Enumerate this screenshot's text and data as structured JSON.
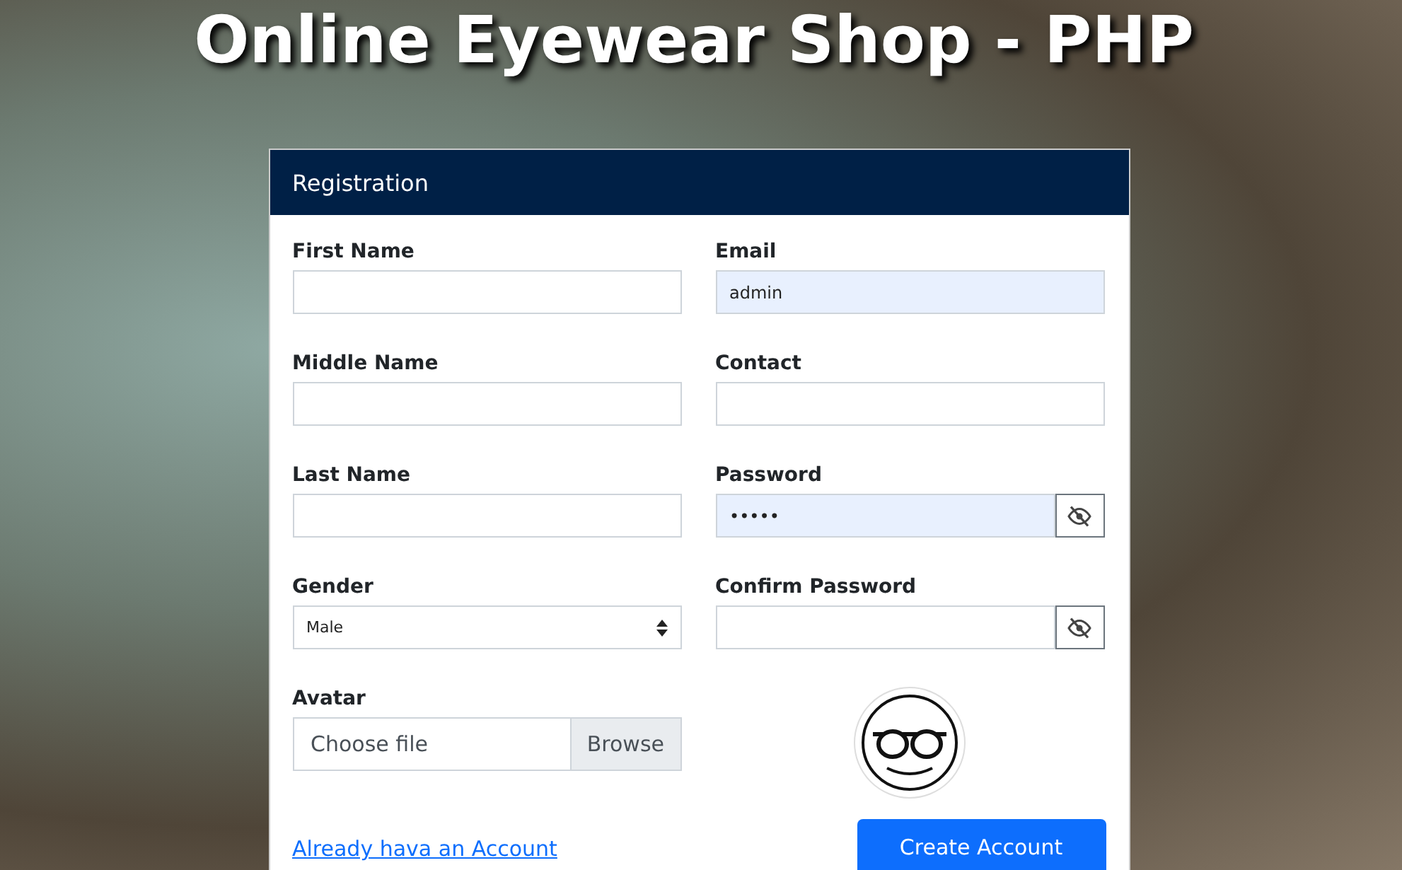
{
  "page_title": "Online Eyewear Shop - PHP",
  "card": {
    "header": "Registration",
    "left_column": [
      {
        "kind": "text",
        "label": "First Name",
        "autofilled": false
      },
      {
        "kind": "text",
        "label": "Middle Name",
        "autofilled": false
      },
      {
        "kind": "text",
        "label": "Last Name",
        "autofilled": false
      },
      {
        "kind": "select",
        "label": "Gender",
        "value": "Male",
        "autofilled": false
      },
      {
        "kind": "file",
        "label": "Avatar",
        "value": "Choose file",
        "button": "Browse",
        "autofilled": false
      }
    ],
    "right_column": [
      {
        "kind": "text",
        "label": "Email",
        "value": "admin",
        "autofilled": true
      },
      {
        "kind": "text",
        "label": "Contact",
        "autofilled": false
      },
      {
        "kind": "password",
        "label": "Password",
        "value": "•••••",
        "autofilled": true
      },
      {
        "kind": "password",
        "label": "Confirm Password",
        "autofilled": false
      },
      {
        "kind": "logo"
      }
    ],
    "login_link": "Already hava an Account",
    "submit_button": "Create Account"
  }
}
